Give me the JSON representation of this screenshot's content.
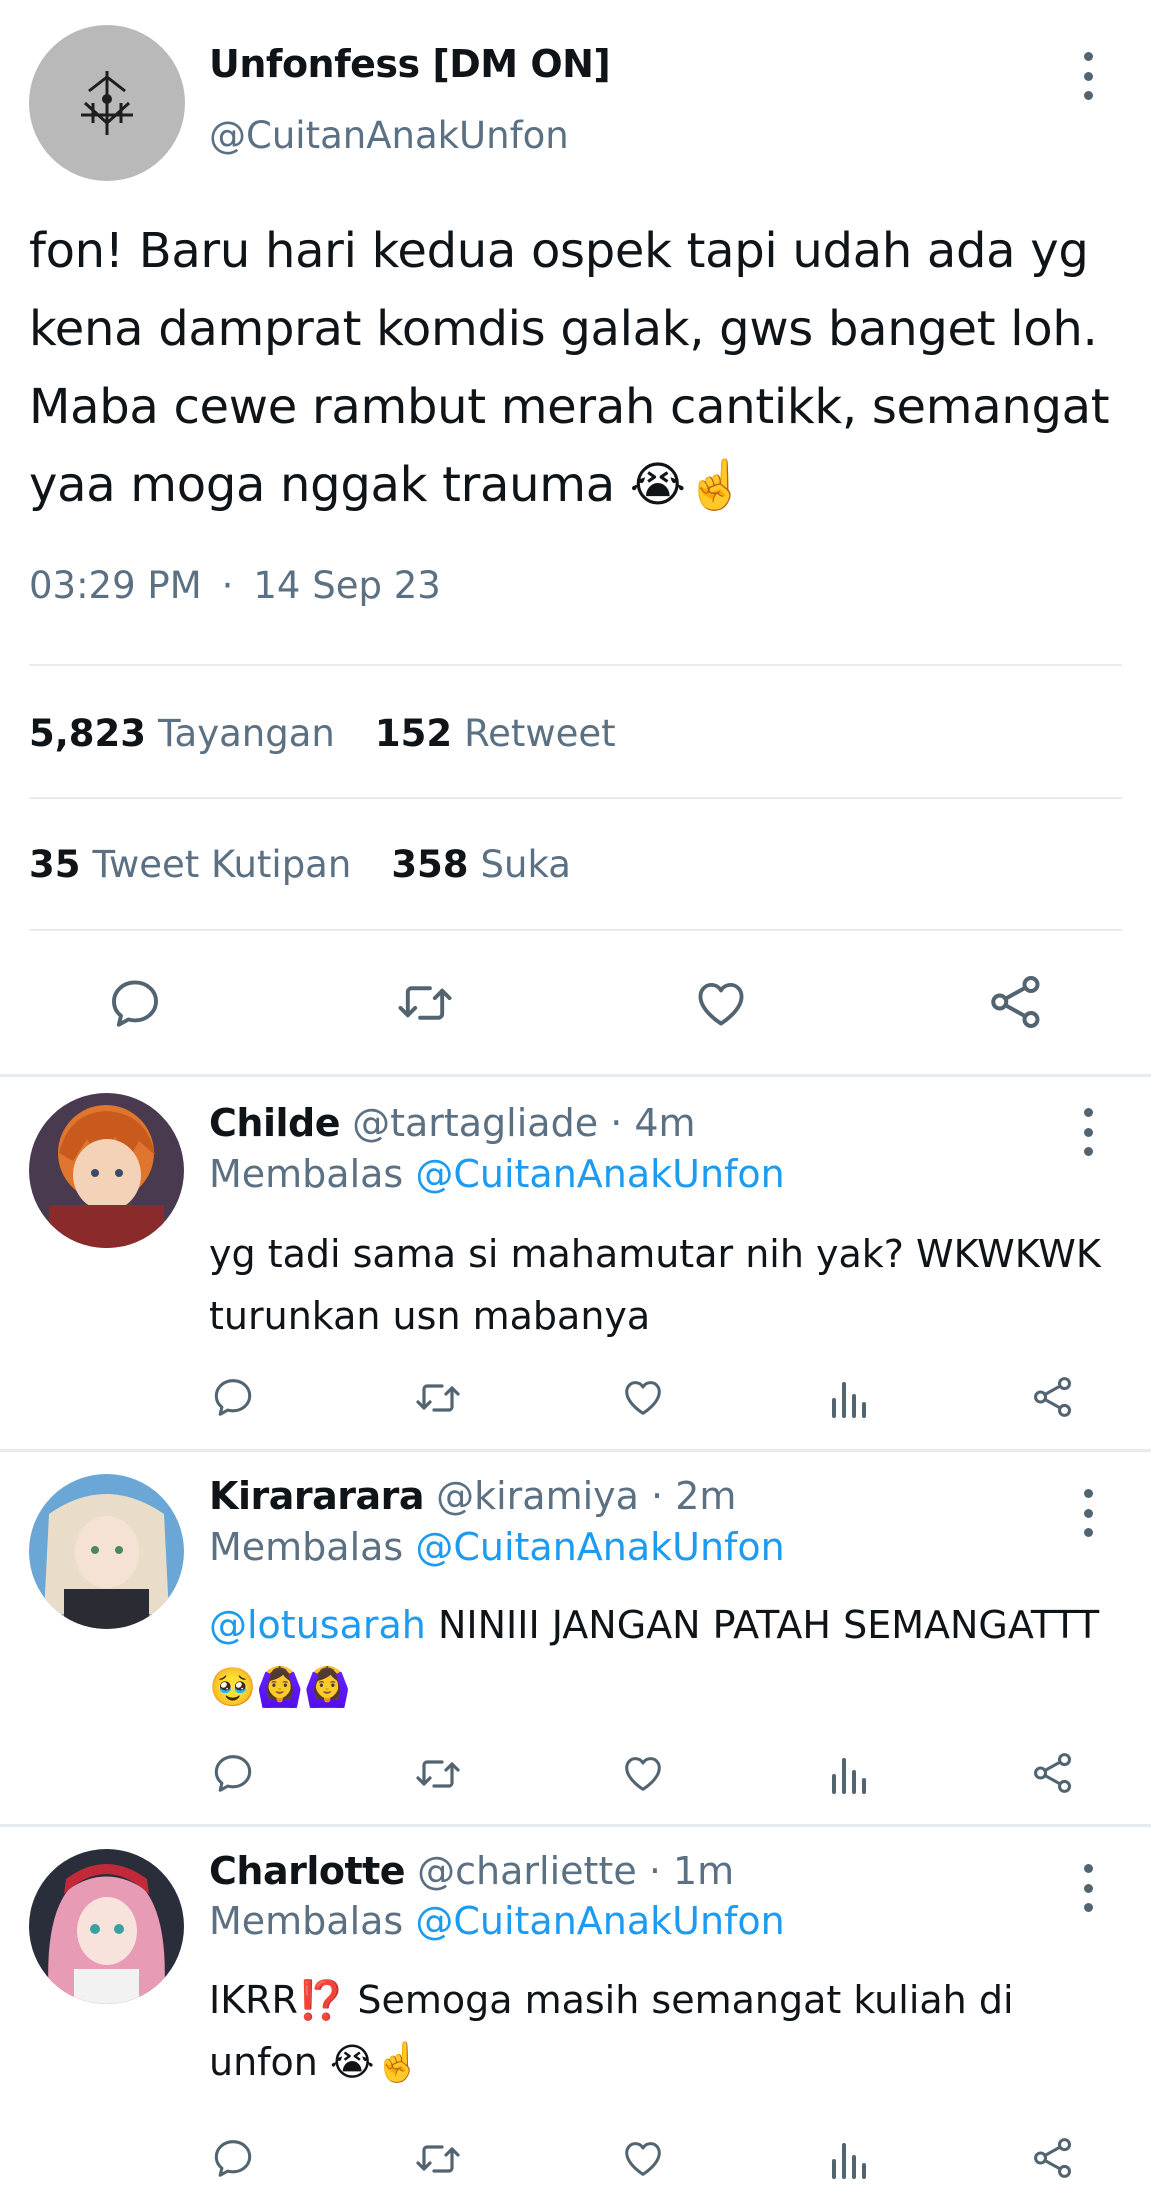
{
  "main": {
    "name": "Unfonfess [DM ON]",
    "handle": "@CuitanAnakUnfon",
    "text_lines": [
      "fon! Baru hari kedua ospek tapi udah ada yg",
      "kena damprat komdis galak, gws banget loh.",
      "Maba cewe rambut merah cantikk, semangat",
      "yaa moga nggak trauma 😭☝️"
    ],
    "time": "03:29 PM",
    "date": "14 Sep 23",
    "views_count": "5,823",
    "views_label": "Tayangan",
    "retweets_count": "152",
    "retweets_label": "Retweet",
    "quotes_count": "35",
    "quotes_label": "Tweet Kutipan",
    "likes_count": "358",
    "likes_label": "Suka"
  },
  "replies": [
    {
      "name": "Childe",
      "handle": "@tartagliade",
      "age": "· 4m",
      "replying_label": "Membalas",
      "replying_to": "@CuitanAnakUnfon",
      "text_lines": [
        "yg tadi sama si mahamutar nih yak? WKWKWK",
        "turunkan usn mabanya"
      ]
    },
    {
      "name": "Kirararara",
      "handle": "@kiramiya",
      "age": "· 2m",
      "replying_label": "Membalas",
      "replying_to": "@CuitanAnakUnfon",
      "mention": "@lotusarah",
      "text_line1": "NINIII JANGAN PATAH SEMANGATTT",
      "text_line2": "🥹🙆‍♀️🙆‍♀️"
    },
    {
      "name": "Charlotte",
      "handle": "@charliette",
      "age": "· 1m",
      "replying_label": "Membalas",
      "replying_to": "@CuitanAnakUnfon",
      "text_lines": [
        "IKRR⁉️ Semoga masih semangat kuliah di",
        "unfon 😭☝️"
      ]
    }
  ],
  "colors": {
    "text": "#0f1419",
    "muted": "#5b7083",
    "link": "#1d9bf0",
    "icon": "#536471",
    "divider": "#e6ecf0"
  },
  "icons": {
    "action_icons": [
      "reply-icon",
      "retweet-icon",
      "like-icon",
      "analytics-icon",
      "share-icon"
    ],
    "more_icon": "more-vertical-icon"
  }
}
